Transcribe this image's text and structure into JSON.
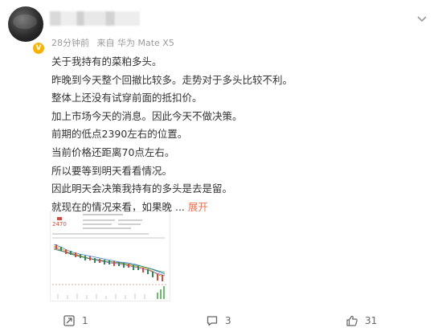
{
  "post": {
    "meta": {
      "time": "28分钟前",
      "source": "来自 华为 Mate X5"
    },
    "lines": [
      "关于我持有的菜粕多头。",
      "昨晚到今天整个回撤比较多。走势对于多头比较不利。",
      "整体上还没有试穿前面的抵扣价。",
      "加上市场今天的消息。因此今天不做决策。",
      "前期的低点2390左右的位置。",
      "当前价格还距离70点左右。",
      "所以要等到明天看看情况。",
      "因此明天会决策我持有的多头是去是留。"
    ],
    "last_line": "就现在的情况来看，如果晚 ...",
    "expand_label": "展开",
    "image": {
      "price_label": "2470"
    }
  },
  "footer": {
    "repost_count": "1",
    "comment_count": "3",
    "like_count": "31"
  },
  "colors": {
    "link": "#eb7350",
    "meta": "#9a9a9a",
    "badge": "#f9b200"
  },
  "icons": [
    "more-icon",
    "verified-badge-icon",
    "repost-icon",
    "comment-icon",
    "like-icon"
  ]
}
